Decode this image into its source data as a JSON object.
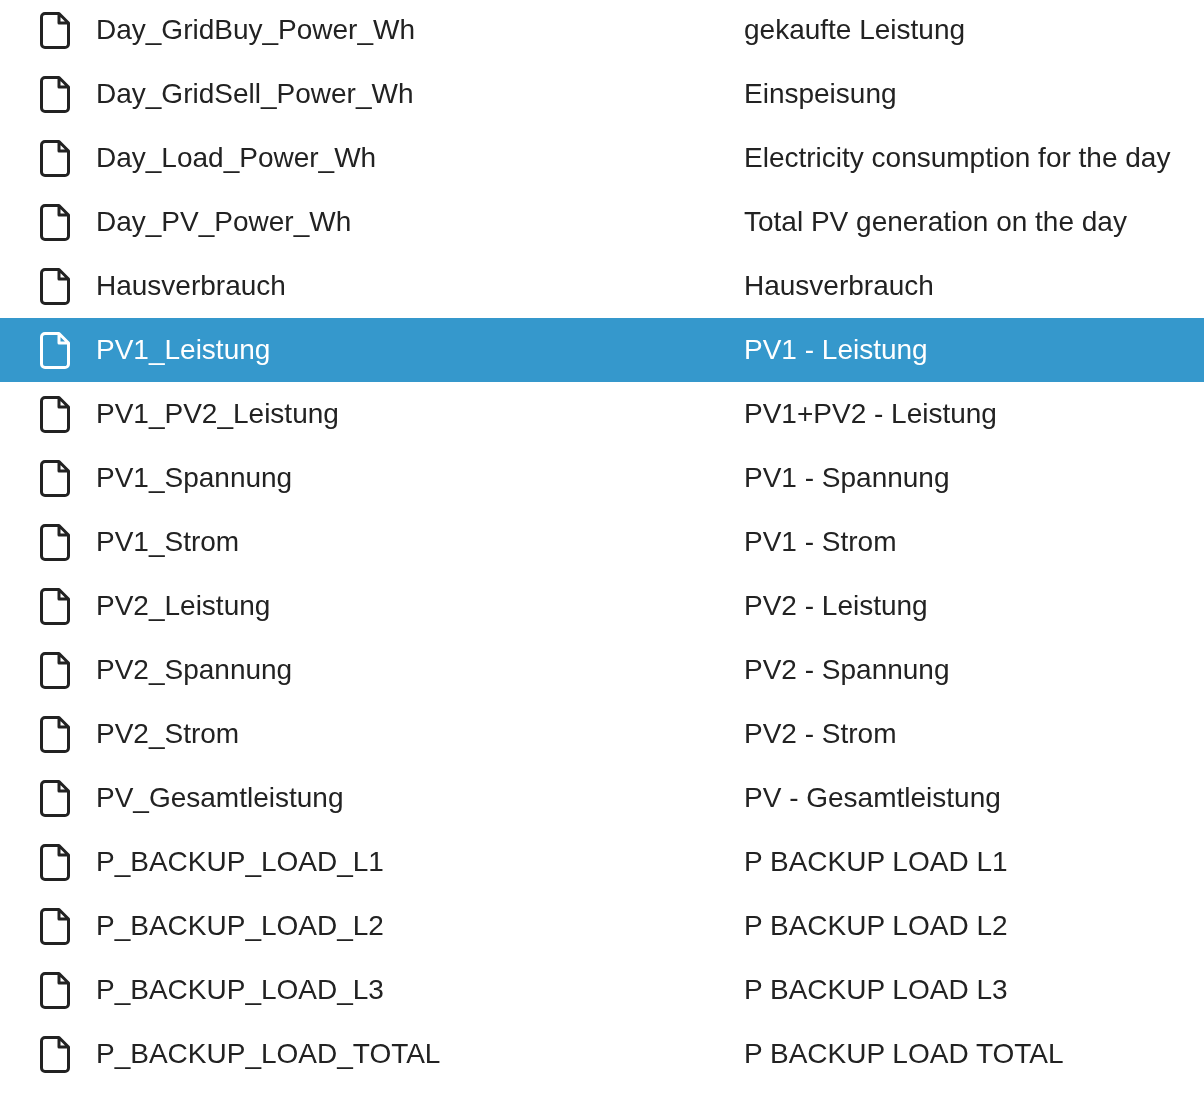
{
  "rows": [
    {
      "name": "Day_GridBuy_Power_Wh",
      "description": "gekaufte Leistung",
      "selected": false
    },
    {
      "name": "Day_GridSell_Power_Wh",
      "description": "Einspeisung",
      "selected": false
    },
    {
      "name": "Day_Load_Power_Wh",
      "description": "Electricity consumption for the day",
      "selected": false
    },
    {
      "name": "Day_PV_Power_Wh",
      "description": "Total PV generation on the day",
      "selected": false
    },
    {
      "name": "Hausverbrauch",
      "description": "Hausverbrauch",
      "selected": false
    },
    {
      "name": "PV1_Leistung",
      "description": "PV1 - Leistung",
      "selected": true
    },
    {
      "name": "PV1_PV2_Leistung",
      "description": "PV1+PV2 - Leistung",
      "selected": false
    },
    {
      "name": "PV1_Spannung",
      "description": "PV1 - Spannung",
      "selected": false
    },
    {
      "name": "PV1_Strom",
      "description": "PV1 - Strom",
      "selected": false
    },
    {
      "name": "PV2_Leistung",
      "description": "PV2 - Leistung",
      "selected": false
    },
    {
      "name": "PV2_Spannung",
      "description": "PV2 - Spannung",
      "selected": false
    },
    {
      "name": "PV2_Strom",
      "description": "PV2 - Strom",
      "selected": false
    },
    {
      "name": "PV_Gesamtleistung",
      "description": "PV - Gesamtleistung",
      "selected": false
    },
    {
      "name": "P_BACKUP_LOAD_L1",
      "description": "P BACKUP LOAD L1",
      "selected": false
    },
    {
      "name": "P_BACKUP_LOAD_L2",
      "description": "P BACKUP LOAD L2",
      "selected": false
    },
    {
      "name": "P_BACKUP_LOAD_L3",
      "description": "P BACKUP LOAD L3",
      "selected": false
    },
    {
      "name": "P_BACKUP_LOAD_TOTAL",
      "description": "P BACKUP LOAD TOTAL",
      "selected": false
    }
  ]
}
